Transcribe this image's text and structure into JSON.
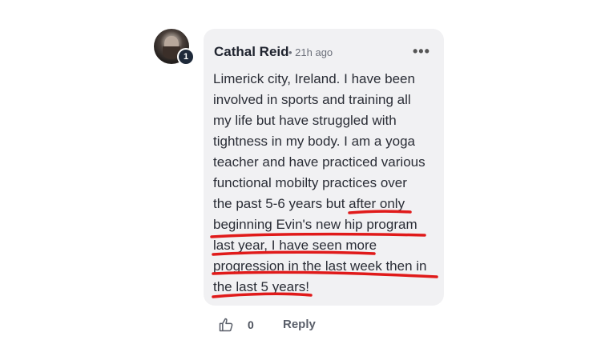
{
  "comment": {
    "author": "Cathal Reid",
    "time": "• 21h ago",
    "badge": "1",
    "more_icon": "•••",
    "lines": [
      "Limerick city, Ireland. I have been",
      "involved in sports and training all",
      "my life but have struggled with",
      "tightness in my body. I am a yoga",
      "teacher and have practiced various",
      "functional mobilty practices over",
      "the past 5-6 years but after only",
      "beginning Evin's new hip program",
      "last year, I have seen more",
      "progression in the last week then in",
      "the last 5 years!"
    ]
  },
  "actions": {
    "like_count": "0",
    "reply_label": "Reply",
    "like_icon": "thumbs-up-icon"
  },
  "colors": {
    "bubble": "#f1f1f3",
    "underline": "#e01a1a",
    "badge": "#1f2a3a"
  }
}
